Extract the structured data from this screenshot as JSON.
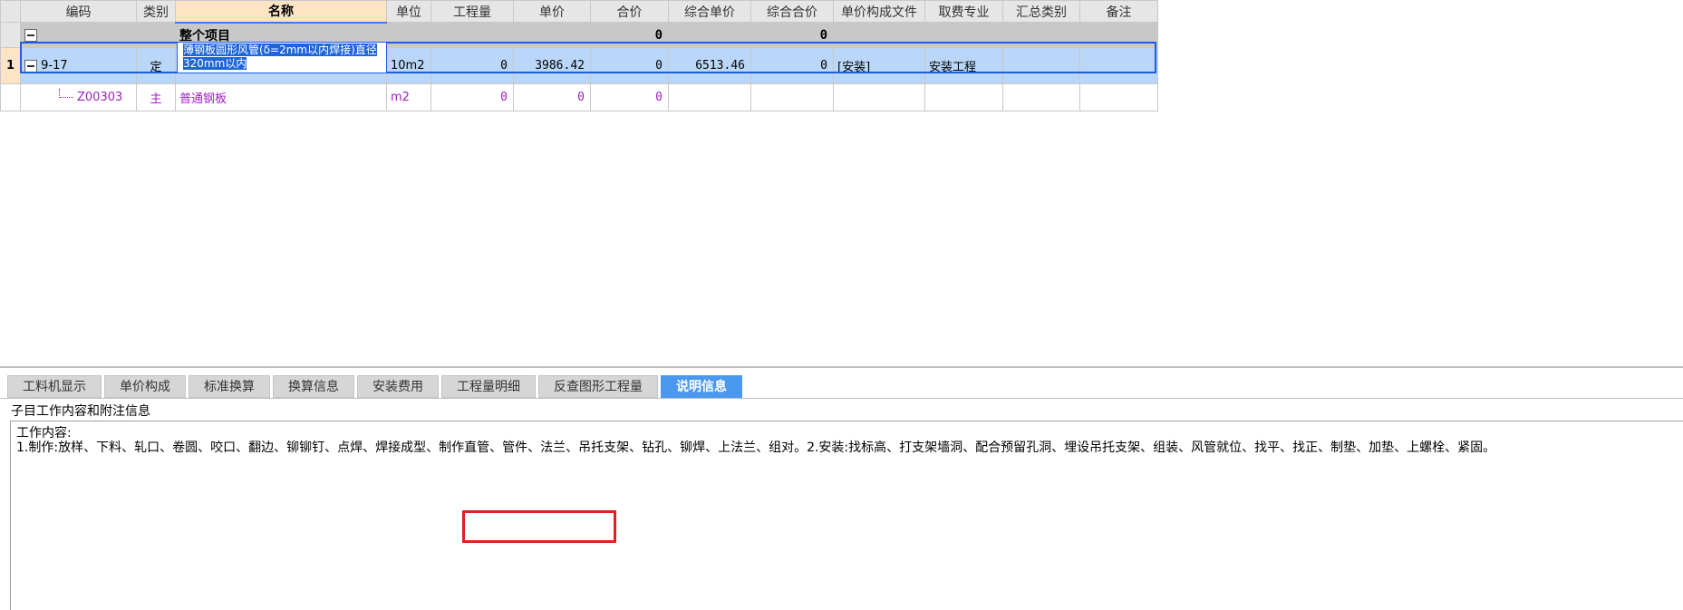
{
  "columns": [
    "编码",
    "类别",
    "名称",
    "单位",
    "工程量",
    "单价",
    "合价",
    "综合单价",
    "综合合价",
    "单价构成文件",
    "取费专业",
    "汇总类别",
    "备注"
  ],
  "total_row": {
    "name": "整个项目",
    "hejia": "0",
    "zonghe_hejia": "0"
  },
  "main_row": {
    "rownum": "1",
    "code": "9-17",
    "type": "定",
    "name": "薄钢板圆形风管(δ=2mm以内焊接)直径320mm以内",
    "unit": "10m2",
    "quantity": "0",
    "unit_price": "3986.42",
    "total": "0",
    "comp_unit_price": "6513.46",
    "comp_total": "0",
    "price_file": "[安装]",
    "fee_major": "安装工程",
    "summary_type": "",
    "remark": ""
  },
  "sub_row": {
    "code": "Z00303",
    "type": "主",
    "name": "普通钢板",
    "unit": "m2",
    "quantity": "0",
    "unit_price": "0",
    "total": "0"
  },
  "tabs": [
    "工料机显示",
    "单价构成",
    "标准换算",
    "换算信息",
    "安装费用",
    "工程量明细",
    "反查图形工程量",
    "说明信息"
  ],
  "active_tab": "说明信息",
  "info": {
    "title": "子目工作内容和附注信息",
    "line1": "工作内容:",
    "line2": "1.制作:放样、下料、轧口、卷圆、咬口、翻边、铆铆钉、点焊、焊接成型、制作直管、管件、法兰、吊托支架、钻孔、铆焊、上法兰、组对。2.安装:找标高、打支架墙洞、配合预留孔洞、埋设吊托支架、组装、风管就位、找平、找正、制垫、加垫、上螺栓、紧固。"
  },
  "colors": {
    "selection": "#1a5fe0",
    "row_selected": "#bad6f8",
    "sub_text": "#a020c0",
    "active_tab": "#4b98f0",
    "highlight_box": "#e02020"
  }
}
